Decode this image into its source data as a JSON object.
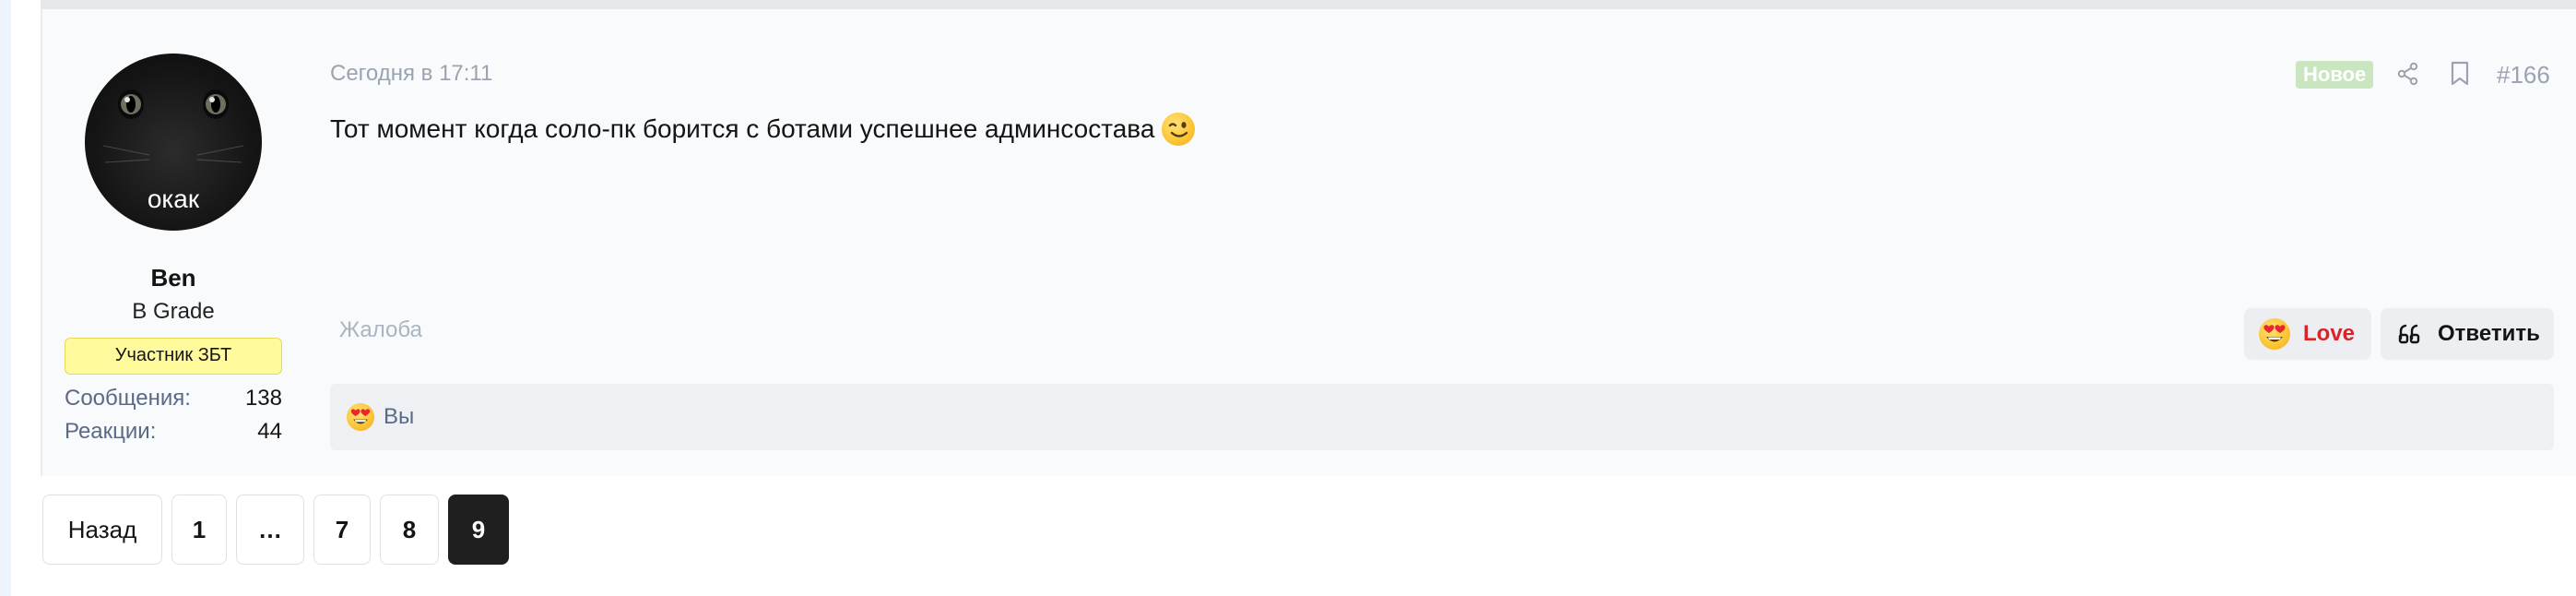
{
  "post": {
    "date": "Сегодня в 17:11",
    "new_badge": "Новое",
    "post_number": "#166",
    "message": "Тот момент когда соло-пк борится с ботами успешнее админсостава",
    "message_emoji_icon": "winking-face-emoji-icon",
    "report_label": "Жалоба"
  },
  "author": {
    "avatar_text": "окак",
    "name": "Ben",
    "title": "B Grade",
    "banner": "Участник ЗБТ",
    "stats": {
      "messages_label": "Сообщения:",
      "messages_value": "138",
      "reactions_label": "Реакции:",
      "reactions_value": "44"
    }
  },
  "actions": {
    "love_label": "Love",
    "love_color": "#d8232a",
    "reply_label": "Ответить",
    "share_icon": "share-icon",
    "bookmark_icon": "bookmark-icon"
  },
  "reactions": {
    "summary": "Вы",
    "reaction_icon": "heart-eyes-emoji-icon"
  },
  "pagination": {
    "back_label": "Назад",
    "pages": [
      "1",
      "…",
      "7",
      "8",
      "9"
    ],
    "current": "9"
  },
  "colors": {
    "new_badge_bg": "#c9e6c1",
    "banner_bg": "#fffb9c",
    "current_page_bg": "#1f1f1f"
  }
}
